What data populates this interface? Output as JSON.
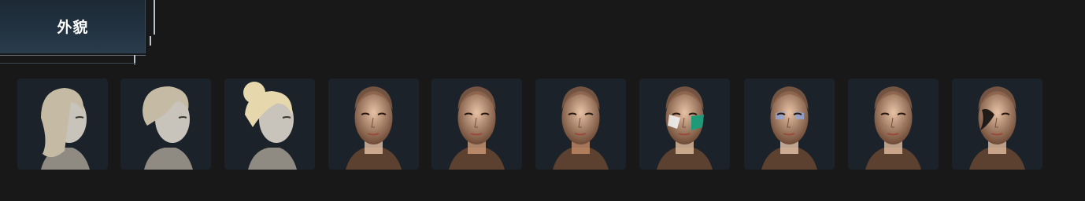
{
  "header": {
    "title": "外貌"
  },
  "cards": [
    {
      "kind": "hair",
      "style": "long-wavy",
      "tone": "light"
    },
    {
      "kind": "hair",
      "style": "short-messy",
      "tone": "light"
    },
    {
      "kind": "hair",
      "style": "bun",
      "tone": "blonde"
    },
    {
      "kind": "face",
      "skin": "#e7c2a5",
      "makeup": "none"
    },
    {
      "kind": "face",
      "skin": "#cd9a77",
      "makeup": "none"
    },
    {
      "kind": "face",
      "skin": "#c68c68",
      "makeup": "none"
    },
    {
      "kind": "face",
      "skin": "#e5c0a3",
      "makeup": "green-cheek-paint"
    },
    {
      "kind": "face",
      "skin": "#e8c5ac",
      "makeup": "blue-eye-paint"
    },
    {
      "kind": "face",
      "skin": "#e4bea0",
      "makeup": "freckles"
    },
    {
      "kind": "face",
      "skin": "#e3bb9d",
      "makeup": "black-eye-tattoo"
    }
  ],
  "colors": {
    "background": "#181818",
    "card": "#1b2229",
    "accent": "#b9c3cb"
  }
}
